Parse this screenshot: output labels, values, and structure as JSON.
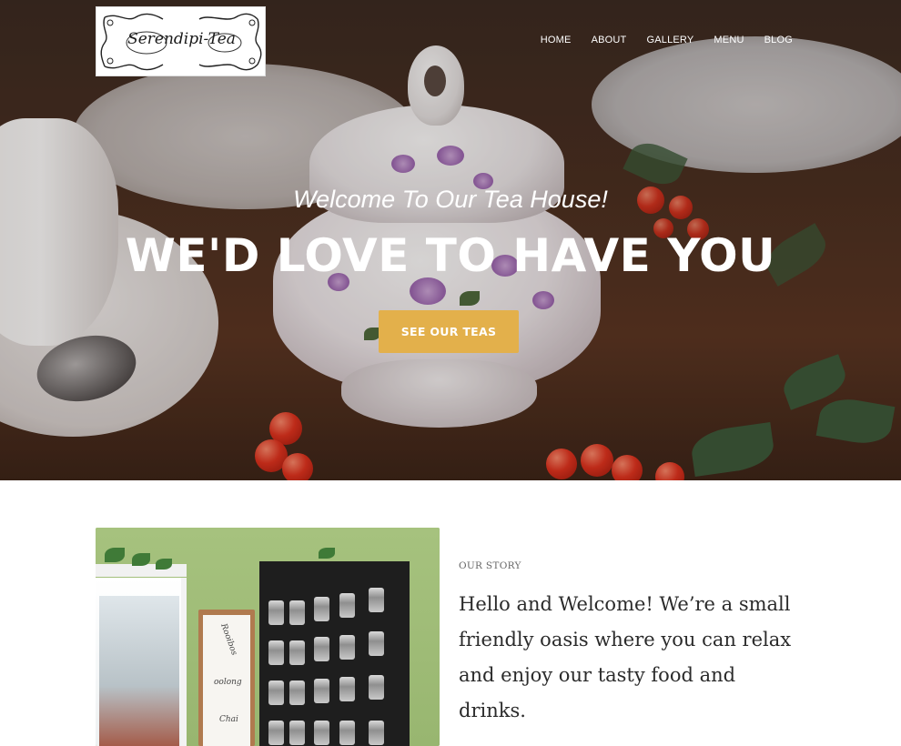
{
  "header": {
    "logo_text": "Serendipi-Tea",
    "nav": [
      {
        "label": "HOME"
      },
      {
        "label": "ABOUT"
      },
      {
        "label": "GALLERY"
      },
      {
        "label": "MENU"
      },
      {
        "label": "BLOG"
      }
    ]
  },
  "hero": {
    "subtitle": "Welcome To Our Tea House!",
    "title": "WE'D LOVE TO HAVE YOU",
    "cta_label": "SEE OUR TEAS"
  },
  "story": {
    "eyebrow": "OUR STORY",
    "text": "Hello and Welcome! We’re a small friendly oasis where you can relax and enjoy our tasty food and drinks.",
    "board_words": [
      "Rooibos",
      "oolong",
      "Chai"
    ]
  },
  "colors": {
    "accent": "#e3b04b",
    "text_dark": "#2b2b2b",
    "eyebrow": "#666666"
  }
}
